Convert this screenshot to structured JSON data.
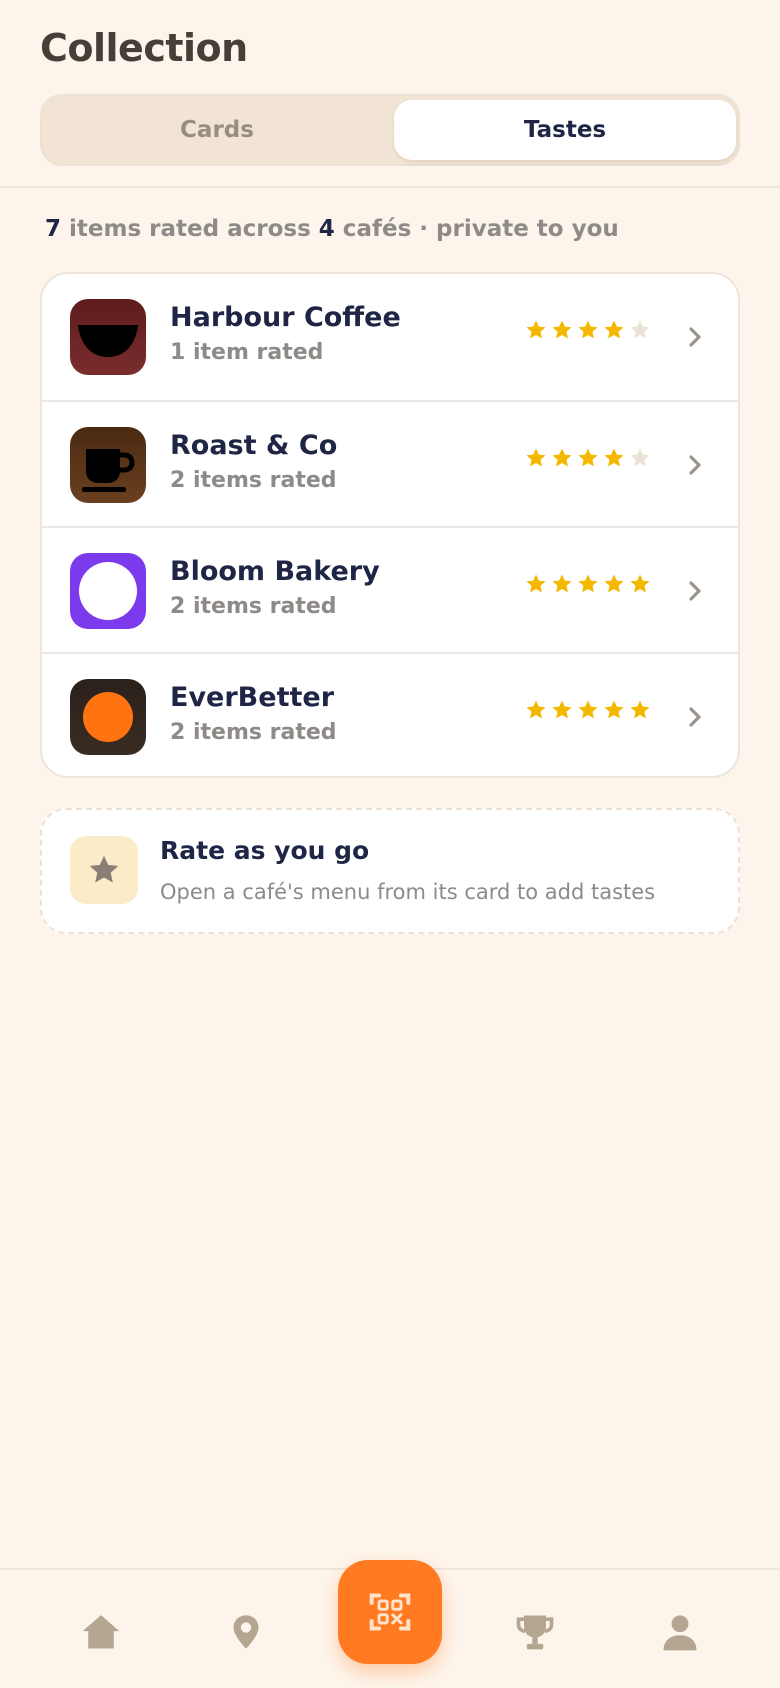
{
  "header": {
    "title": "Collection",
    "tabs": [
      {
        "label": "Cards",
        "selected": false
      },
      {
        "label": "Tastes",
        "selected": true
      }
    ]
  },
  "summary": {
    "items_count": "7",
    "text_mid": " items rated across ",
    "cafes_count": "4",
    "text_end": " cafés · private to you"
  },
  "cafes": [
    {
      "name": "Harbour Coffee",
      "subtitle": "1 item rated",
      "rating": 4,
      "logo_icon": "bowl-icon",
      "logo_bg": "#6f2424"
    },
    {
      "name": "Roast & Co",
      "subtitle": "2 items rated",
      "rating": 4,
      "logo_icon": "coffee-cup-icon",
      "logo_bg": "#5a3418"
    },
    {
      "name": "Bloom Bakery",
      "subtitle": "2 items rated",
      "rating": 5,
      "logo_icon": "white-circle-icon",
      "logo_bg": "#7c3aed"
    },
    {
      "name": "EverBetter",
      "subtitle": "2 items rated",
      "rating": 5,
      "logo_icon": "orange-circle-icon",
      "logo_bg": "#2f241d"
    }
  ],
  "tip": {
    "title": "Rate as you go",
    "text": "Open a café's menu from its card to add tastes",
    "icon": "star-icon"
  },
  "bottom_nav": {
    "items": [
      "home-icon",
      "location-pin-icon",
      "qr-scan-icon",
      "trophy-icon",
      "profile-icon"
    ]
  },
  "colors": {
    "background": "#fdf5ec",
    "accent": "#ff7a21",
    "star_filled": "#f5b800",
    "star_empty": "#ece2d4",
    "text_primary": "#1f2544",
    "text_muted": "#8d8a87"
  }
}
